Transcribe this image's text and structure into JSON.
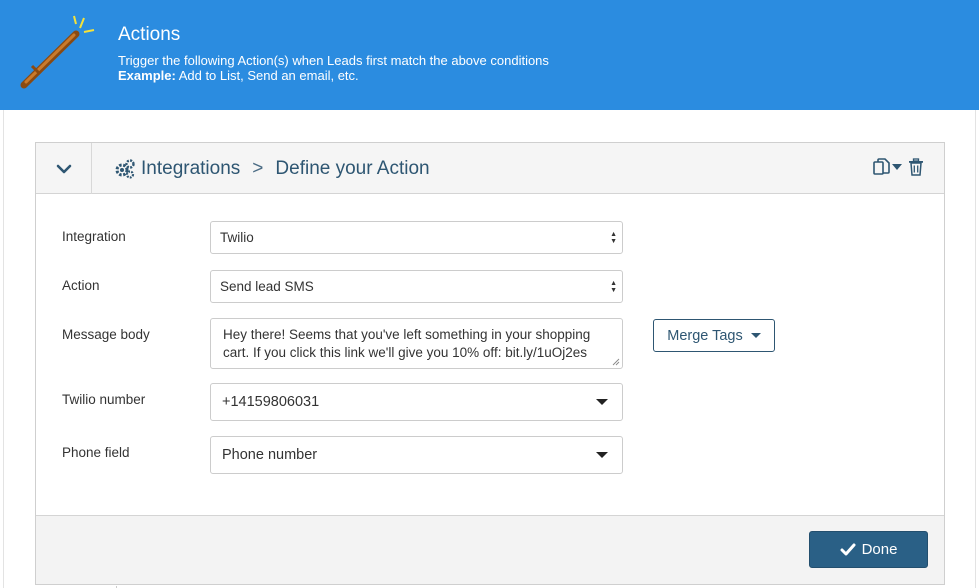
{
  "banner": {
    "title": "Actions",
    "line1": "Trigger the following Action(s) when Leads first match the above conditions",
    "example_label": "Example:",
    "example_text": " Add to List, Send an email, etc."
  },
  "header": {
    "breadcrumb_root": "Integrations",
    "breadcrumb_sep": ">",
    "breadcrumb_current": "Define your Action"
  },
  "form": {
    "integration": {
      "label": "Integration",
      "value": "Twilio"
    },
    "action": {
      "label": "Action",
      "value": "Send lead SMS"
    },
    "message": {
      "label": "Message body",
      "value": "Hey there! Seems that you've left something in your shopping cart. If you click this link we'll give you 10% off: bit.ly/1uOj2es"
    },
    "twilio_number": {
      "label": "Twilio number",
      "value": "+14159806031"
    },
    "phone_field": {
      "label": "Phone field",
      "value": "Phone number"
    }
  },
  "merge_tags_label": "Merge Tags",
  "done_label": "Done",
  "colors": {
    "banner": "#2b8ce0",
    "primary": "#2a6086",
    "text_dark_blue": "#2e5672"
  }
}
